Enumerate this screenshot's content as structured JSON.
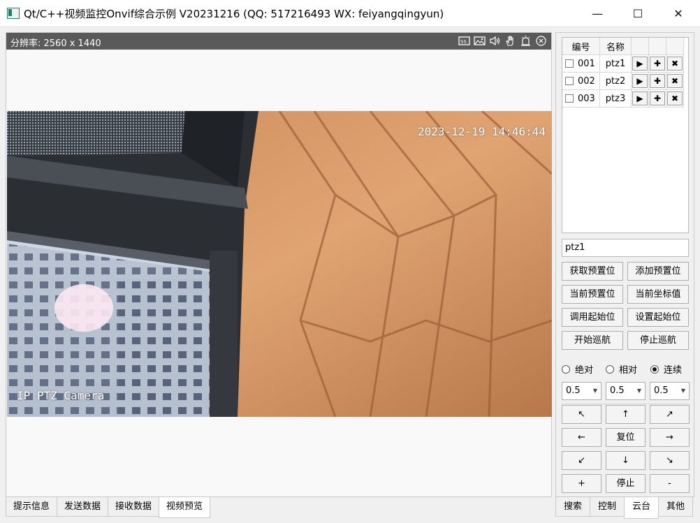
{
  "window": {
    "title": "Qt/C++视频监控Onvif综合示例 V20231216 (QQ: 517216493 WX: feiyangqingyun)",
    "min_glyph": "—",
    "max_glyph": "☐",
    "close_glyph": "✕"
  },
  "video": {
    "resolution_label": "分辨率: 2560 x 1440",
    "header_icons": [
      "screenshot-icon",
      "image-icon",
      "volume-icon",
      "hand-icon",
      "alarm-icon",
      "close-circle-icon"
    ],
    "osd_timestamp": "2023-12-19 14:46:44",
    "osd_camera_name": "IP PTZ Camera"
  },
  "bottom_tabs": [
    "提示信息",
    "发送数据",
    "接收数据",
    "视频预览"
  ],
  "bottom_tabs_active": 3,
  "ptz_table": {
    "headers": [
      "编号",
      "名称"
    ],
    "rows": [
      {
        "id": "001",
        "name": "ptz1"
      },
      {
        "id": "002",
        "name": "ptz2"
      },
      {
        "id": "003",
        "name": "ptz3"
      }
    ],
    "row_buttons": [
      "▶",
      "✚",
      "✖"
    ]
  },
  "ptz_input_value": "ptz1",
  "action_buttons": [
    [
      "获取预置位",
      "添加预置位"
    ],
    [
      "当前预置位",
      "当前坐标值"
    ],
    [
      "调用起始位",
      "设置起始位"
    ],
    [
      "开始巡航",
      "停止巡航"
    ]
  ],
  "move_modes": {
    "options": [
      "绝对",
      "相对",
      "连续"
    ],
    "selected": "连续"
  },
  "speed_combos": [
    "0.5",
    "0.5",
    "0.5"
  ],
  "direction_pad": [
    [
      "↖",
      "↑",
      "↗"
    ],
    [
      "←",
      "复位",
      "→"
    ],
    [
      "↙",
      "↓",
      "↘"
    ],
    [
      "+",
      "停止",
      "-"
    ]
  ],
  "right_tabs": [
    "搜索",
    "控制",
    "云台",
    "其他"
  ],
  "right_tabs_active": 2
}
